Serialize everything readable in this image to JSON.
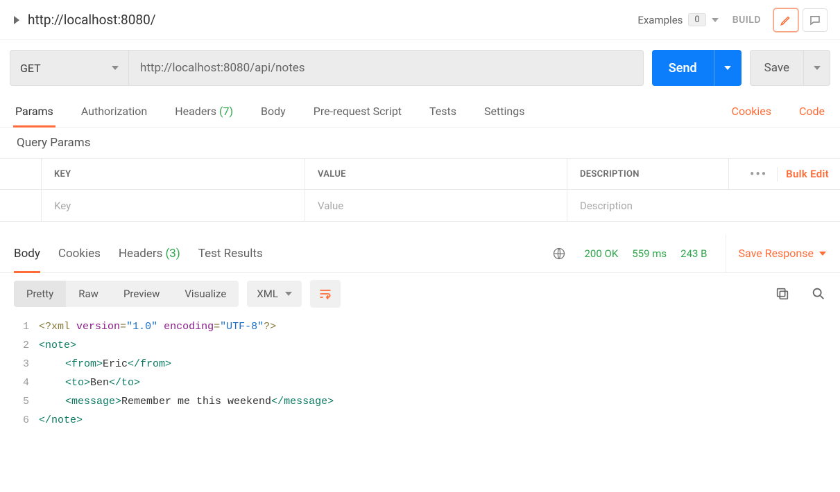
{
  "title": "http://localhost:8080/",
  "examples": {
    "label": "Examples",
    "count": "0"
  },
  "build": "BUILD",
  "request": {
    "method": "GET",
    "url": "http://localhost:8080/api/notes",
    "send": "Send",
    "save": "Save"
  },
  "req_tabs": {
    "params": "Params",
    "authorization": "Authorization",
    "headers": "Headers",
    "headers_count": "(7)",
    "body": "Body",
    "prerequest": "Pre-request Script",
    "tests": "Tests",
    "settings": "Settings",
    "cookies": "Cookies",
    "code": "Code"
  },
  "query_params": {
    "title": "Query Params",
    "col_key": "KEY",
    "col_value": "VALUE",
    "col_desc": "DESCRIPTION",
    "bulk_edit": "Bulk Edit",
    "ph_key": "Key",
    "ph_value": "Value",
    "ph_desc": "Description"
  },
  "response": {
    "tabs": {
      "body": "Body",
      "cookies": "Cookies",
      "headers": "Headers",
      "headers_count": "(3)",
      "test_results": "Test Results"
    },
    "status": "200 OK",
    "time": "559 ms",
    "size": "243 B",
    "save_response": "Save Response",
    "view": {
      "pretty": "Pretty",
      "raw": "Raw",
      "preview": "Preview",
      "visualize": "Visualize"
    },
    "format": "XML",
    "code_lines": [
      "1",
      "2",
      "3",
      "4",
      "5",
      "6"
    ],
    "code": {
      "l1_pi": "<?xml",
      "l1_attr1": "version",
      "l1_eq1": "=",
      "l1_str1": "\"1.0\"",
      "l1_attr2": "encoding",
      "l1_eq2": "=",
      "l1_str2": "\"UTF-8\"",
      "l1_end": "?>",
      "l2_tag": "<note>",
      "l3_open": "<from>",
      "l3_text": "Eric",
      "l3_close": "</from>",
      "l4_open": "<to>",
      "l4_text": "Ben",
      "l4_close": "</to>",
      "l5_open": "<message>",
      "l5_text": "Remember me this weekend",
      "l5_close": "</message>",
      "l6_tag": "</note>"
    }
  }
}
